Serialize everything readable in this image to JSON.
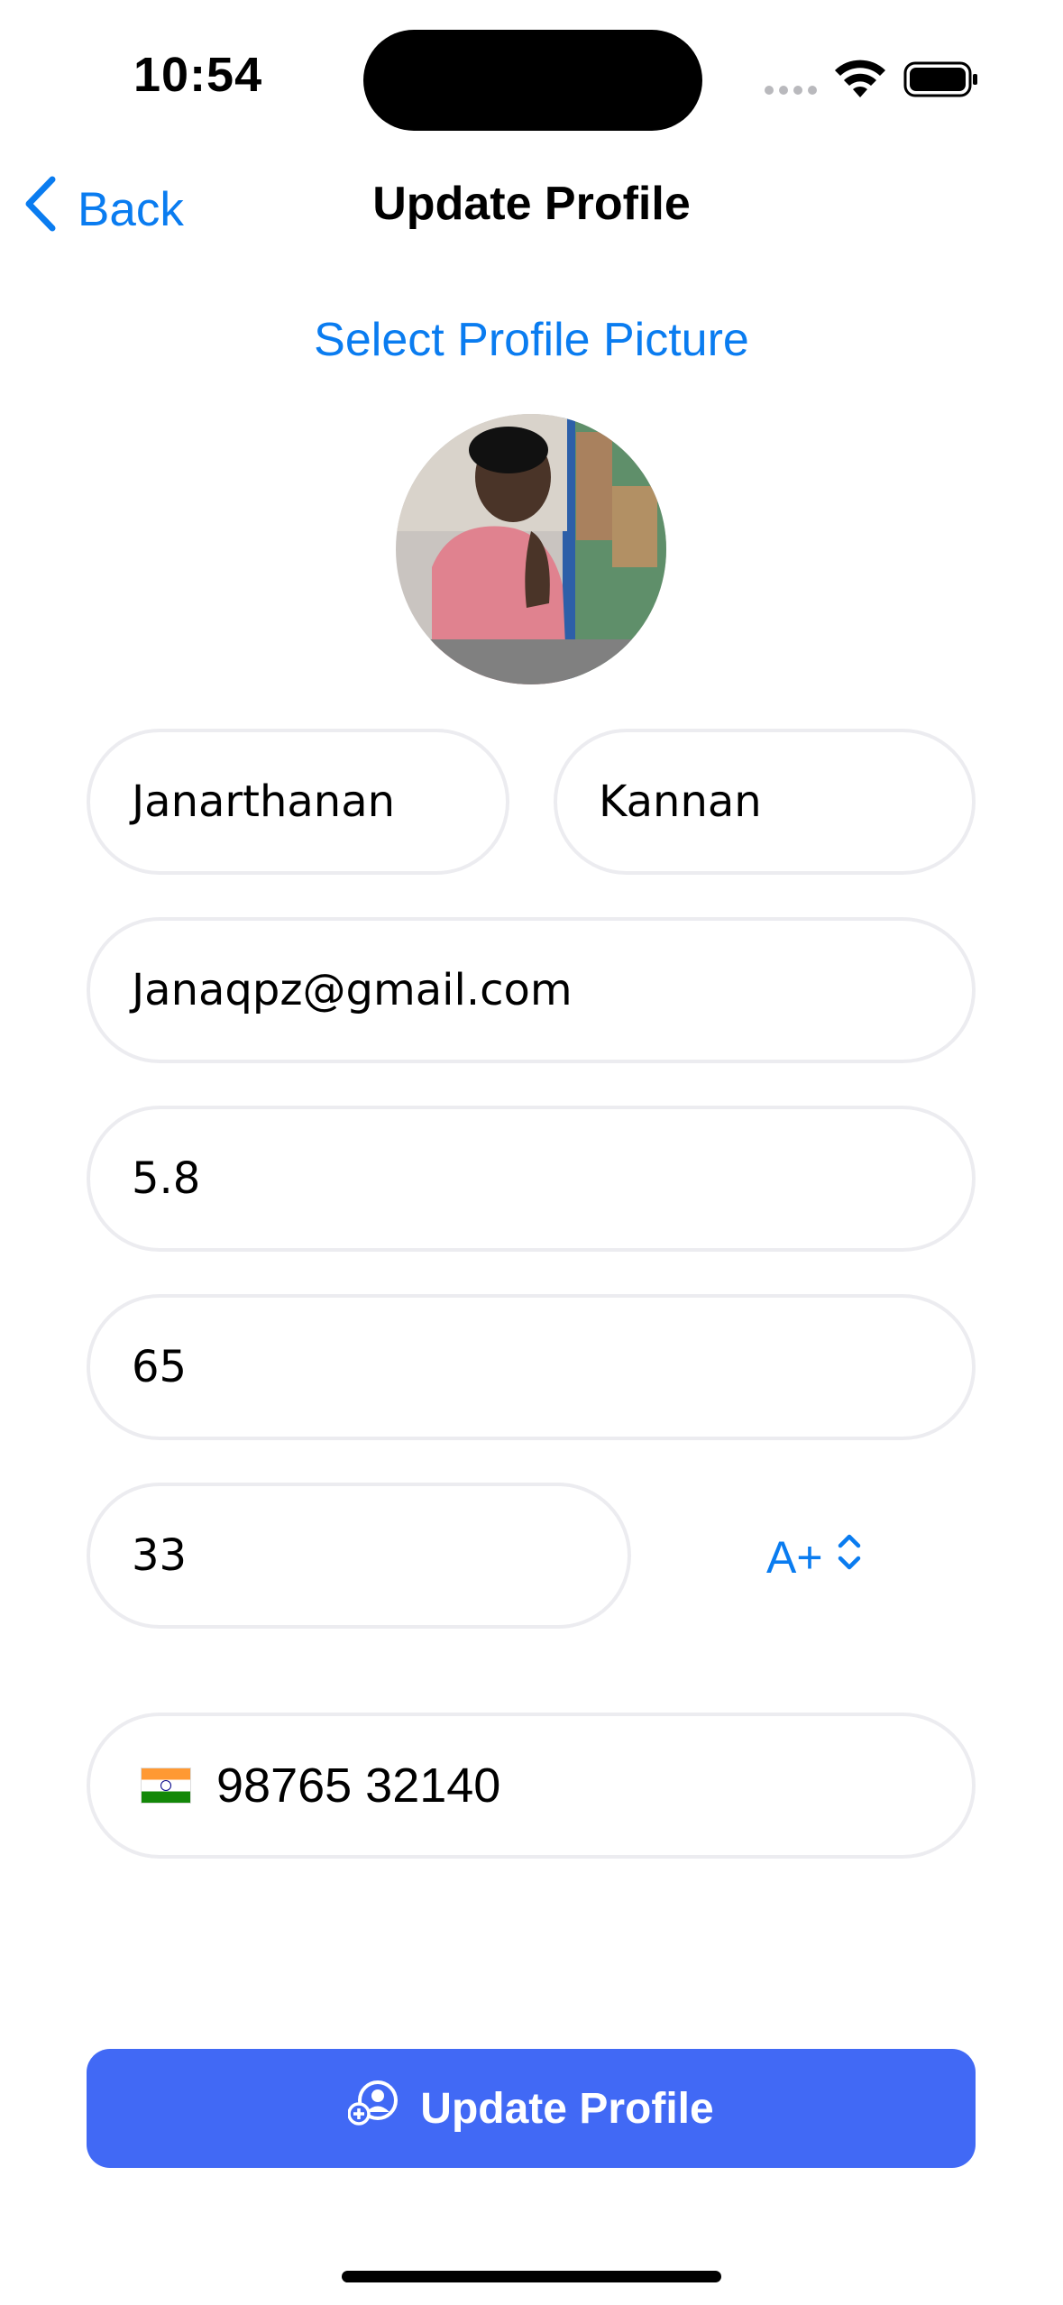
{
  "status_bar": {
    "time": "10:54"
  },
  "nav": {
    "back_label": "Back",
    "title": "Update Profile"
  },
  "profile": {
    "select_picture_label": "Select Profile Picture"
  },
  "form": {
    "first_name": "Janarthanan",
    "last_name": "Kannan",
    "email": "Janaqpz@gmail.com",
    "height": "5.8",
    "weight": "65",
    "age": "33",
    "blood_group": "A+",
    "phone_country_flag": "India",
    "phone": "98765 32140"
  },
  "update_button_label": "Update Profile",
  "colors": {
    "accent": "#0a7cf0",
    "button": "#4169f5",
    "field_border": "#ececf0"
  }
}
